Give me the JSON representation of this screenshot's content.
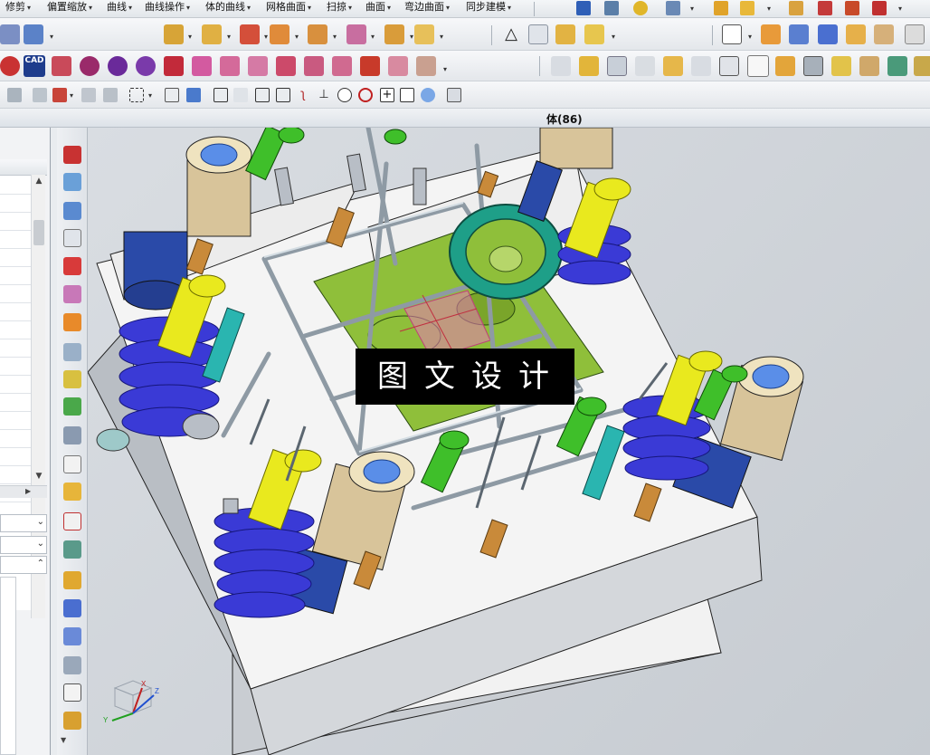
{
  "menubar": {
    "items": [
      {
        "label": "修剪",
        "key": "trim"
      },
      {
        "label": "偏置缩放",
        "key": "offset-scale"
      },
      {
        "label": "曲线",
        "key": "curve"
      },
      {
        "label": "曲线操作",
        "key": "curve-operation"
      },
      {
        "label": "体的曲线",
        "key": "curves-from-body"
      },
      {
        "label": "网格曲面",
        "key": "mesh-surface"
      },
      {
        "label": "扫掠",
        "key": "sweep"
      },
      {
        "label": "曲面",
        "key": "surface"
      },
      {
        "label": "弯边曲面",
        "key": "flange-surface"
      },
      {
        "label": "同步建模",
        "key": "synchronous-modeling"
      }
    ]
  },
  "window": {
    "title": "体(86)"
  },
  "toolbar_icons": {
    "cad_badge": "CAD"
  },
  "viewport": {
    "watermark": "图文设计",
    "triad_labels": {
      "x": "X",
      "y": "Y",
      "z": "Z"
    }
  },
  "colors": {
    "plate": "#f4f4f4",
    "spring": "#3a3ad6",
    "bolt_green": "#3fbf2a",
    "pin_yellow": "#e9e91e",
    "bushing_tan": "#d8c49a",
    "ring_teal": "#1e9f88",
    "cavity_green": "#8fbf3a",
    "frame_gray": "#a9b4bc"
  }
}
